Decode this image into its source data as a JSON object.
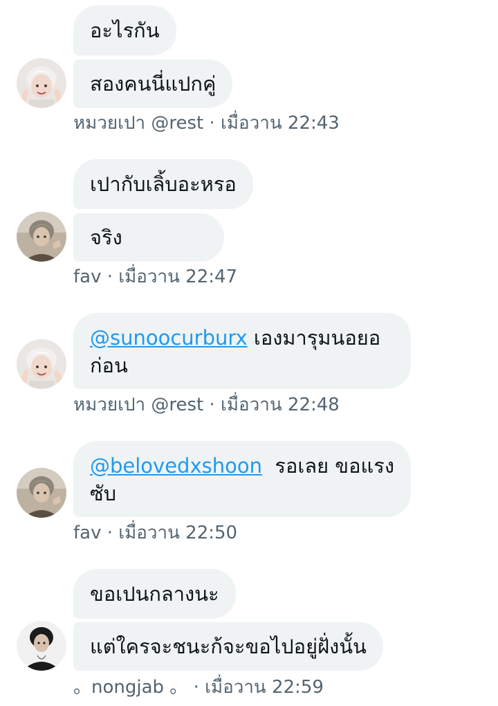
{
  "messages": [
    {
      "bubbles": [
        "อะไรกัน",
        "สองคนนี่แปกคู่"
      ],
      "sender": "หมวยเปา @rest",
      "time_label": "เมื่อวาน 22:43"
    },
    {
      "bubbles": [
        "เปากับเลิ้บอะหรอ",
        "จริง"
      ],
      "sender": "fav",
      "time_label": "เมื่อวาน 22:47"
    },
    {
      "mention": "@sunoocurburx",
      "text": " เองมารุมนอยอ ก่อน",
      "sender": "หมวยเปา @rest",
      "time_label": "เมื่อวาน 22:48"
    },
    {
      "mention": "@belovedxshoon",
      "text": "  รอเลย ขอแรง ซับ",
      "sender": "fav",
      "time_label": "เมื่อวาน 22:50"
    },
    {
      "bubbles": [
        "ขอเปนกลางนะ",
        "แต่ใครจะชนะก้จะขอไปอยู่ฝั่งนั้น"
      ],
      "sender": "。nongjab 。",
      "time_label": "เมื่อวาน 22:59"
    }
  ],
  "separator": "·",
  "icons": [
    "avatar-rest",
    "avatar-fav",
    "avatar-nongjab"
  ],
  "colors": {
    "bubble_bg": "#eff3f4",
    "text": "#0f1419",
    "meta": "#536471",
    "mention": "#1d9bf0"
  }
}
